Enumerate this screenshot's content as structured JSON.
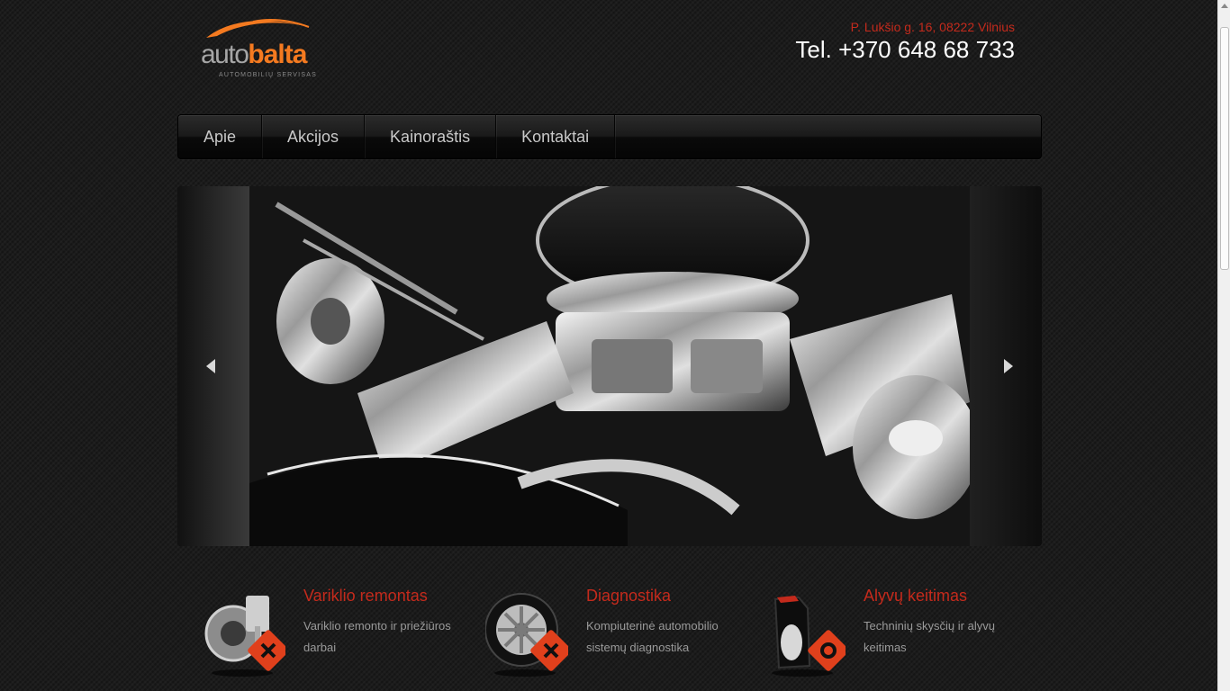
{
  "header": {
    "logo": {
      "brand_light": "auto",
      "brand_bold": "balta",
      "tagline": "AUTOMOBILIŲ SERVISAS"
    },
    "address": "P. Lukšio g. 16, 08222 Vilnius",
    "phone": "Tel. +370 648 68 733"
  },
  "nav": {
    "items": [
      {
        "label": "Apie"
      },
      {
        "label": "Akcijos"
      },
      {
        "label": "Kainoraštis"
      },
      {
        "label": "Kontaktai"
      }
    ]
  },
  "slider": {
    "image": "engine-photo",
    "prev_icon": "arrow-left-icon",
    "next_icon": "arrow-right-icon"
  },
  "services": [
    {
      "title": "Variklio remontas",
      "description": "Variklio remonto ir priežiūros darbai",
      "icon": "engine-gear-icon"
    },
    {
      "title": "Diagnostika",
      "description": "Kompiuterinė automobilio sistemų diagnostika",
      "icon": "wheel-icon"
    },
    {
      "title": "Alyvų keitimas",
      "description": "Techninių skysčių ir alyvų keitimas",
      "icon": "oil-can-icon"
    }
  ],
  "colors": {
    "accent_red": "#c42a1c",
    "logo_orange": "#f47a20",
    "background": "#1c1c1c"
  }
}
